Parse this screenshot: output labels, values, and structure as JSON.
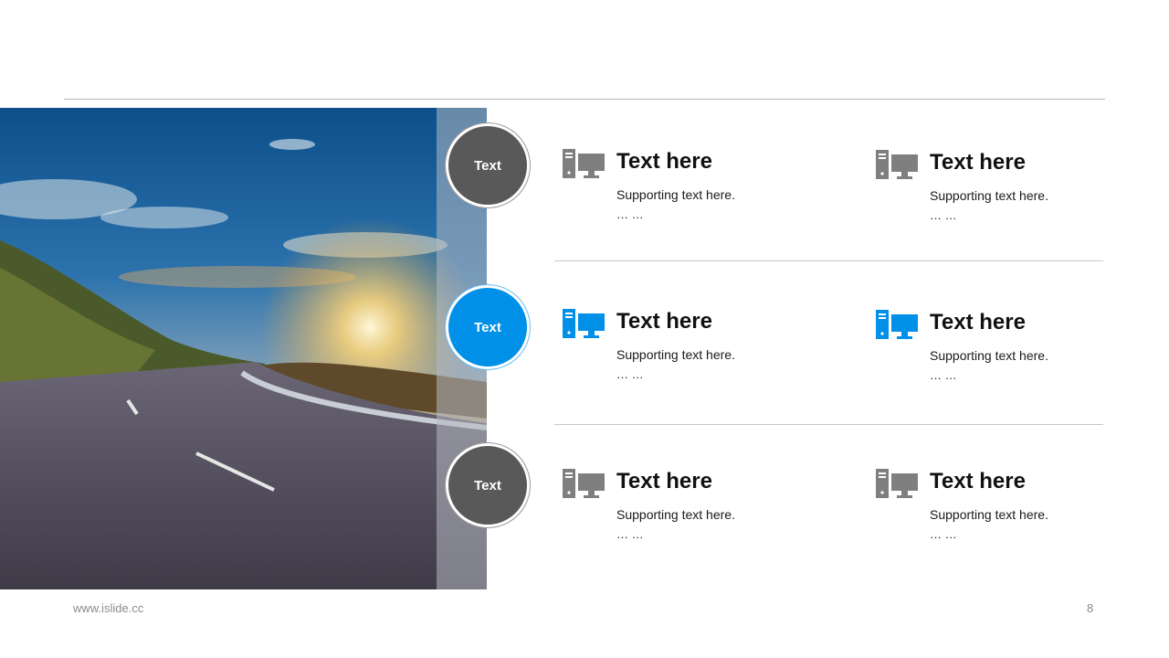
{
  "colors": {
    "accent": "#0090e8",
    "gray": "#595959",
    "icon_gray": "#7f7f7f"
  },
  "circles": [
    {
      "label": "Text",
      "color": "gray"
    },
    {
      "label": "Text",
      "color": "blue"
    },
    {
      "label": "Text",
      "color": "gray"
    }
  ],
  "items": [
    {
      "icon": "computer-icon",
      "title": "Text here",
      "text": "Supporting  text here.",
      "ellipsis": "… …"
    },
    {
      "icon": "computer-icon",
      "title": "Text here",
      "text": "Supporting  text here.",
      "ellipsis": "… …"
    },
    {
      "icon": "computer-icon",
      "title": "Text here",
      "text": "Supporting  text here.",
      "ellipsis": "… …"
    },
    {
      "icon": "computer-icon",
      "title": "Text here",
      "text": "Supporting  text here.",
      "ellipsis": "… …"
    },
    {
      "icon": "computer-icon",
      "title": "Text here",
      "text": "Supporting  text here.",
      "ellipsis": "… …"
    },
    {
      "icon": "computer-icon",
      "title": "Text here",
      "text": "Supporting  text here.",
      "ellipsis": "… …"
    }
  ],
  "footer": {
    "url": "www.islide.cc",
    "page": "8"
  }
}
